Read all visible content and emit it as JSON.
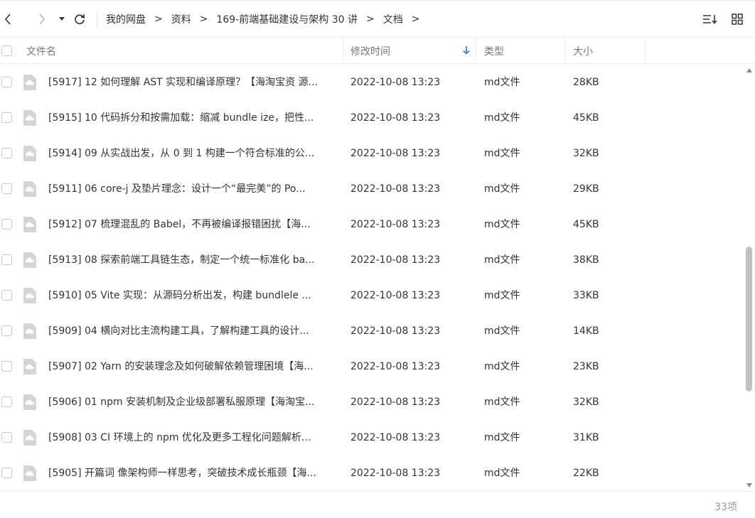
{
  "nav": {
    "breadcrumbs": [
      "我的网盘",
      "资料",
      "169-前端基础建设与架构 30 讲",
      "文档"
    ],
    "separator": ">"
  },
  "columns": {
    "name": "文件名",
    "modified": "修改时间",
    "type": "类型",
    "size": "大小",
    "sorted_by": "modified",
    "sort_direction": "descending"
  },
  "files": [
    {
      "name": "[5917] 12  如何理解 AST 实现和编译原理？【海淘宝资 源...",
      "modified": "2022-10-08 13:23",
      "type": "md文件",
      "size": "28KB"
    },
    {
      "name": "[5915] 10  代码拆分和按需加载：缩减 bundle ize，把性...",
      "modified": "2022-10-08 13:23",
      "type": "md文件",
      "size": "45KB"
    },
    {
      "name": "[5914] 09  从实战出发，从 0 到 1 构建一个符合标准的公...",
      "modified": "2022-10-08 13:23",
      "type": "md文件",
      "size": "32KB"
    },
    {
      "name": "[5911] 06  core-j 及垫片理念：设计一个“最完美”的 Po...",
      "modified": "2022-10-08 13:23",
      "type": "md文件",
      "size": "29KB"
    },
    {
      "name": "[5912] 07  梳理混乱的 Babel，不再被编译报错困扰【海...",
      "modified": "2022-10-08 13:23",
      "type": "md文件",
      "size": "45KB"
    },
    {
      "name": "[5913] 08  探索前端工具链生态，制定一个统一标准化 ba...",
      "modified": "2022-10-08 13:23",
      "type": "md文件",
      "size": "38KB"
    },
    {
      "name": "[5910] 05  Vite 实现：从源码分析出发，构建 bundlele ...",
      "modified": "2022-10-08 13:23",
      "type": "md文件",
      "size": "33KB"
    },
    {
      "name": "[5909] 04  横向对比主流构建工具，了解构建工具的设计...",
      "modified": "2022-10-08 13:23",
      "type": "md文件",
      "size": "14KB"
    },
    {
      "name": "[5907] 02  Yarn 的安装理念及如何破解依赖管理困境【海...",
      "modified": "2022-10-08 13:23",
      "type": "md文件",
      "size": "23KB"
    },
    {
      "name": "[5906] 01  npm 安装机制及企业级部署私服原理【海淘宝...",
      "modified": "2022-10-08 13:23",
      "type": "md文件",
      "size": "32KB"
    },
    {
      "name": "[5908] 03  CI 环境上的 npm 优化及更多工程化问题解析...",
      "modified": "2022-10-08 13:23",
      "type": "md文件",
      "size": "31KB"
    },
    {
      "name": "[5905] 开篇词  像架构师一样思考，突破技术成长瓶颈【海...",
      "modified": "2022-10-08 13:23",
      "type": "md文件",
      "size": "22KB"
    }
  ],
  "scroll": {
    "position": 0.66,
    "visible_fraction": 0.36
  },
  "footer": {
    "item_count": "33项"
  },
  "colors": {
    "accent": "#2e8ae6",
    "file_icon": "#d5d5d5"
  },
  "icons": {
    "back": "chevron-left-icon",
    "forward": "chevron-right-icon",
    "history": "dropdown-caret-icon",
    "refresh": "refresh-icon",
    "sort": "sort-list-icon",
    "grid": "grid-view-icon",
    "file": "cloud-file-icon"
  }
}
